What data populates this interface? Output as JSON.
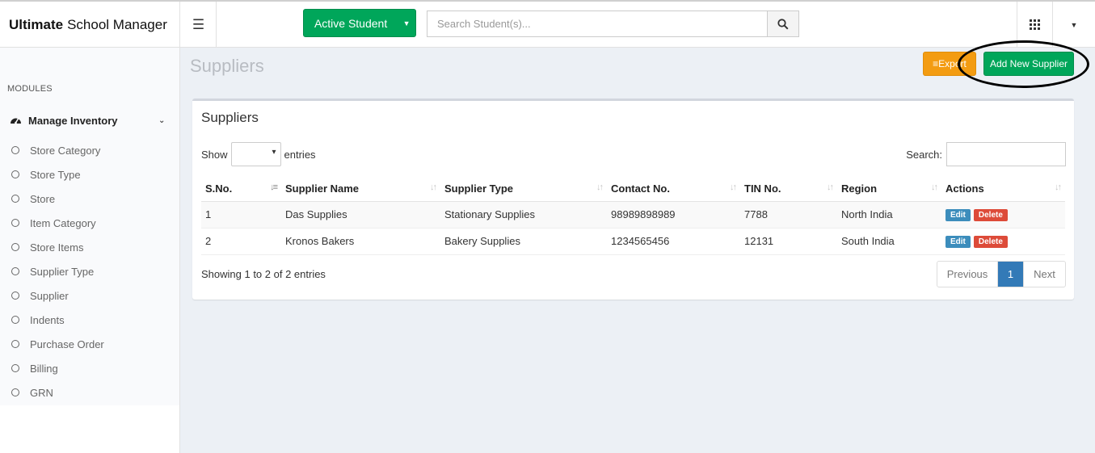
{
  "brand": {
    "bold": "Ultimate",
    "rest": "School Manager"
  },
  "topbar": {
    "active_student_label": "Active Student",
    "search_placeholder": "Search Student(s)..."
  },
  "sidebar": {
    "modules_label": "MODULES",
    "parent_label": "Manage Inventory",
    "items": [
      {
        "label": "Store Category"
      },
      {
        "label": "Store Type"
      },
      {
        "label": "Store"
      },
      {
        "label": "Item Category"
      },
      {
        "label": "Store Items"
      },
      {
        "label": "Supplier Type"
      },
      {
        "label": "Supplier"
      },
      {
        "label": "Indents"
      },
      {
        "label": "Purchase Order"
      },
      {
        "label": "Billing"
      },
      {
        "label": "GRN"
      }
    ]
  },
  "page": {
    "title": "Suppliers",
    "export_label": "Export",
    "add_label": "Add New Supplier"
  },
  "box": {
    "title": "Suppliers",
    "show_label": "Show",
    "entries_label": "entries",
    "search_label": "Search:",
    "columns": [
      "S.No.",
      "Supplier Name",
      "Supplier Type",
      "Contact No.",
      "TIN No.",
      "Region",
      "Actions"
    ],
    "rows": [
      {
        "sno": "1",
        "name": "Das Supplies",
        "type": "Stationary Supplies",
        "contact": "98989898989",
        "tin": "7788",
        "region": "North India"
      },
      {
        "sno": "2",
        "name": "Kronos Bakers",
        "type": "Bakery Supplies",
        "contact": "1234565456",
        "tin": "12131",
        "region": "South India"
      }
    ],
    "edit_label": "Edit",
    "delete_label": "Delete",
    "info": "Showing 1 to 2 of 2 entries",
    "pager": {
      "prev": "Previous",
      "current": "1",
      "next": "Next"
    }
  },
  "colors": {
    "green": "#00a65a",
    "orange": "#f39c12",
    "blue": "#3c8dbc",
    "red": "#dd4b39",
    "page_bg": "#ecf0f5"
  }
}
